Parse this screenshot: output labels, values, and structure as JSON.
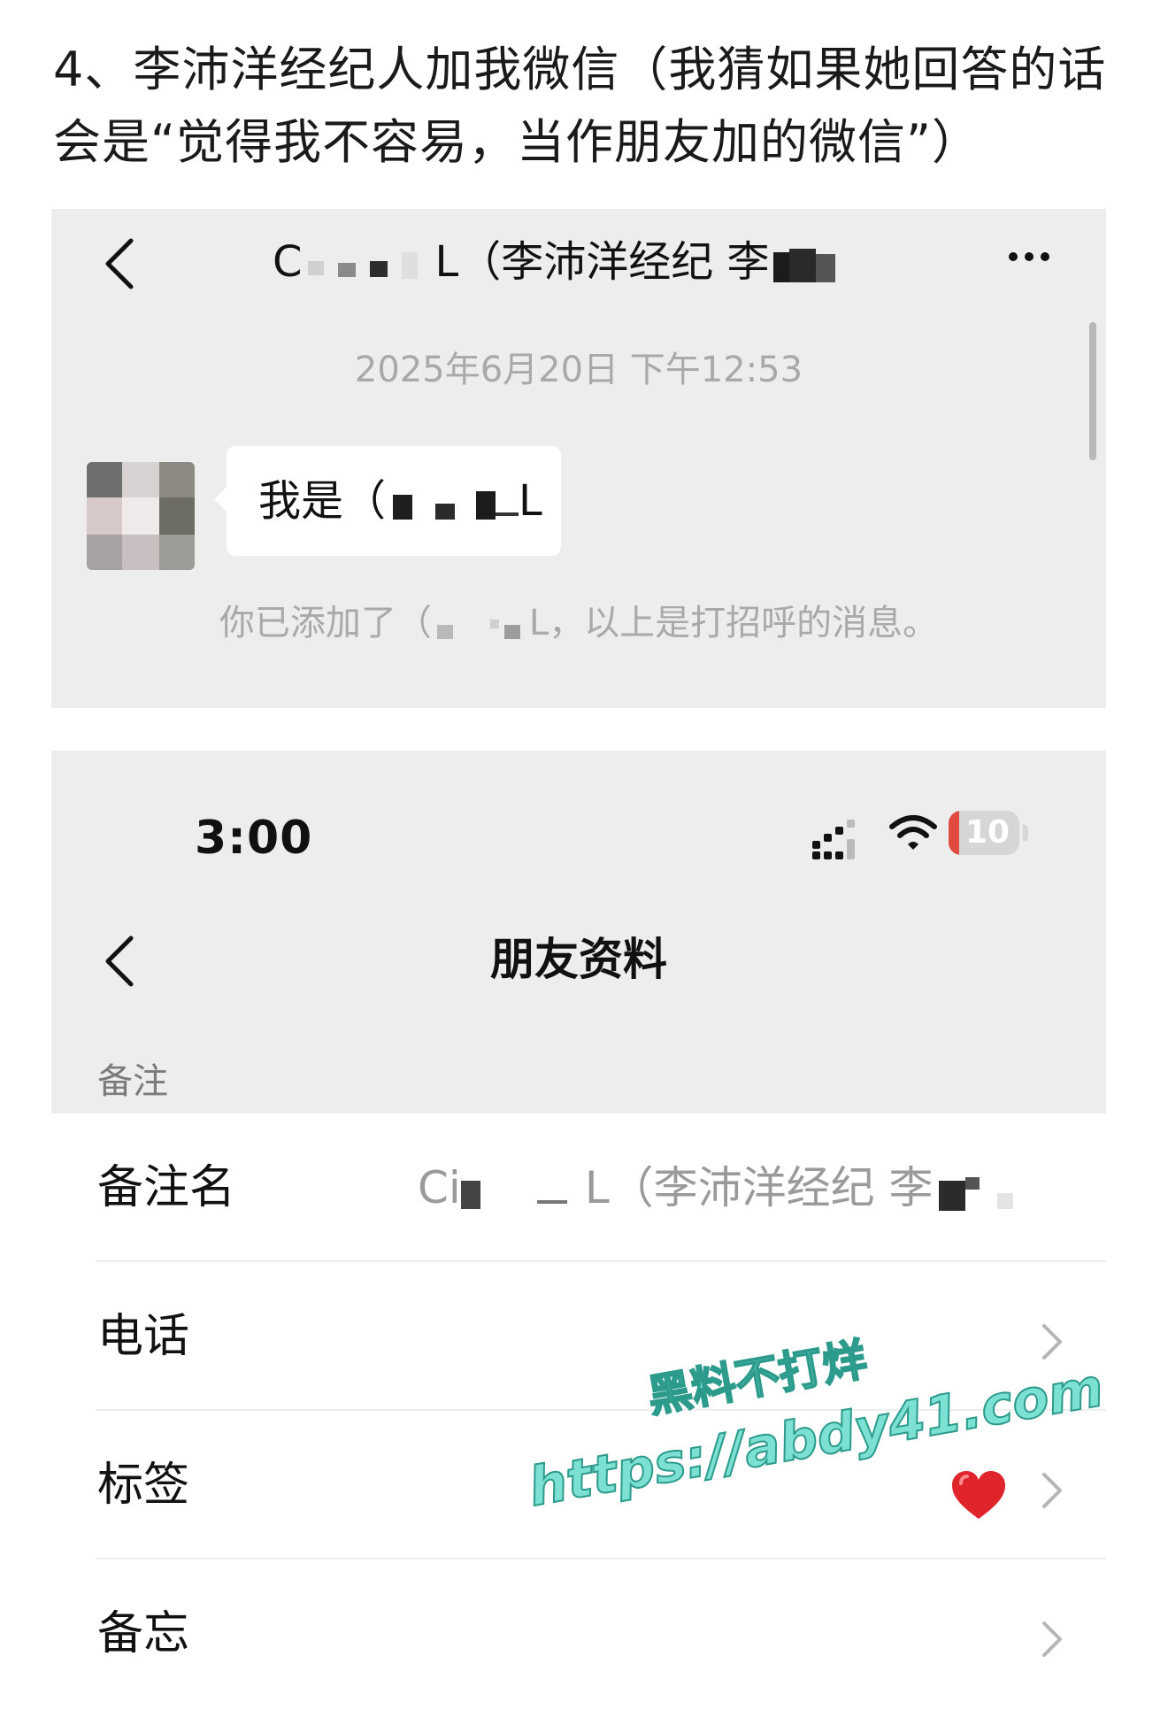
{
  "caption": "4、李沛洋经纪人加我微信（我猜如果她回答的话会是“觉得我不容易，当作朋友加的微信”）",
  "chat": {
    "title_prefix": "C",
    "title_suffix": "L（李沛洋经纪 李",
    "timestamp": "2025年6月20日 下午12:53",
    "message_prefix": "我是（",
    "message_suffix": "L",
    "system_prefix": "你已添加了（",
    "system_suffix": "L，以上是打招呼的消息。"
  },
  "profile": {
    "status_time": "3:00",
    "battery": "10",
    "title": "朋友资料",
    "section_label": "备注",
    "rows": [
      {
        "label": "备注名",
        "value_prefix": "Ci",
        "value_suffix": "L（李沛洋经纪 李"
      },
      {
        "label": "电话"
      },
      {
        "label": "标签"
      },
      {
        "label": "备忘"
      }
    ]
  },
  "watermark": {
    "line1": "黑料不打烊",
    "line2": "https://abdy41.com"
  },
  "colors": {
    "chat_bg": "#ededed",
    "bubble_bg": "#ffffff",
    "watermark_fill": "#7ce0d3",
    "watermark_stroke": "#2d9b8c",
    "battery_low": "#e14a3f"
  },
  "icons": [
    "chevron-left-icon",
    "more-icon",
    "signal-icon",
    "wifi-icon",
    "battery-icon",
    "chevron-right-icon",
    "heart-icon"
  ]
}
